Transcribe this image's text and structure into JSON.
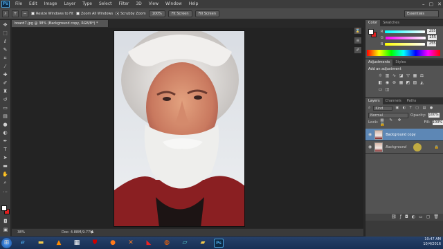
{
  "menubar": {
    "logo": "Ps",
    "items": [
      "File",
      "Edit",
      "Image",
      "Layer",
      "Type",
      "Select",
      "Filter",
      "3D",
      "View",
      "Window",
      "Help"
    ],
    "window_controls": [
      "–",
      "▢",
      "✕"
    ]
  },
  "options_bar": {
    "resize_windows_label": "Resize Windows to Fit",
    "zoom_all_label": "Zoom All Windows",
    "scrubby_zoom_label": "Scrubby Zoom",
    "btn_100": "100%",
    "btn_fit": "Fit Screen",
    "btn_fill": "Fill Screen",
    "workspace": "Essentials"
  },
  "document": {
    "tab_title": "board7.jpg @ 38% (Background copy, RGB/8*) *",
    "zoom": "38%",
    "doc_info": "Doc: 4.88M/9.77M"
  },
  "color_panel": {
    "tabs": [
      "Color",
      "Swatches"
    ],
    "r_label": "R",
    "g_label": "G",
    "b_label": "B",
    "r_value": "255",
    "g_value": "255",
    "b_value": "255"
  },
  "adjustments_panel": {
    "tabs": [
      "Adjustments",
      "Styles"
    ],
    "heading": "Add an adjustment"
  },
  "layers_panel": {
    "tabs": [
      "Layers",
      "Channels",
      "Paths"
    ],
    "kind_label": "Kind",
    "blend_mode": "Normal",
    "opacity_label": "Opacity:",
    "opacity_value": "100%",
    "lock_label": "Lock:",
    "fill_label": "Fill:",
    "fill_value": "100%",
    "layers": [
      {
        "name": "Background copy"
      },
      {
        "name": "Background"
      }
    ]
  },
  "taskbar": {
    "time": "10:47 AM",
    "date": "10/4/2016"
  },
  "colors": {
    "accent": "#4aa3df",
    "selected_layer": "#5d87b5",
    "fg_swatch": "#ffffff",
    "bg_swatch": "#e02020"
  }
}
